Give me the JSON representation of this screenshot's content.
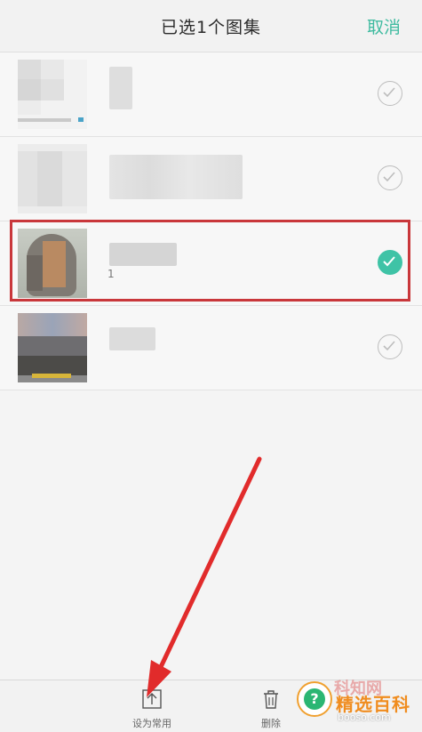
{
  "header": {
    "title": "已选1个图集",
    "cancel": "取消"
  },
  "albums": [
    {
      "count": "",
      "selected": false
    },
    {
      "count": "",
      "selected": false
    },
    {
      "count": "1",
      "selected": true
    },
    {
      "count": "",
      "selected": false
    }
  ],
  "toolbar": {
    "set_common_label": "设为常用",
    "delete_label": "删除"
  },
  "watermark": {
    "brand": "精选百科",
    "domain": "booso.com",
    "faint": "科知网"
  },
  "colors": {
    "accent": "#3fc3a6",
    "highlight": "#c9373b",
    "arrow": "#e12b2b"
  }
}
